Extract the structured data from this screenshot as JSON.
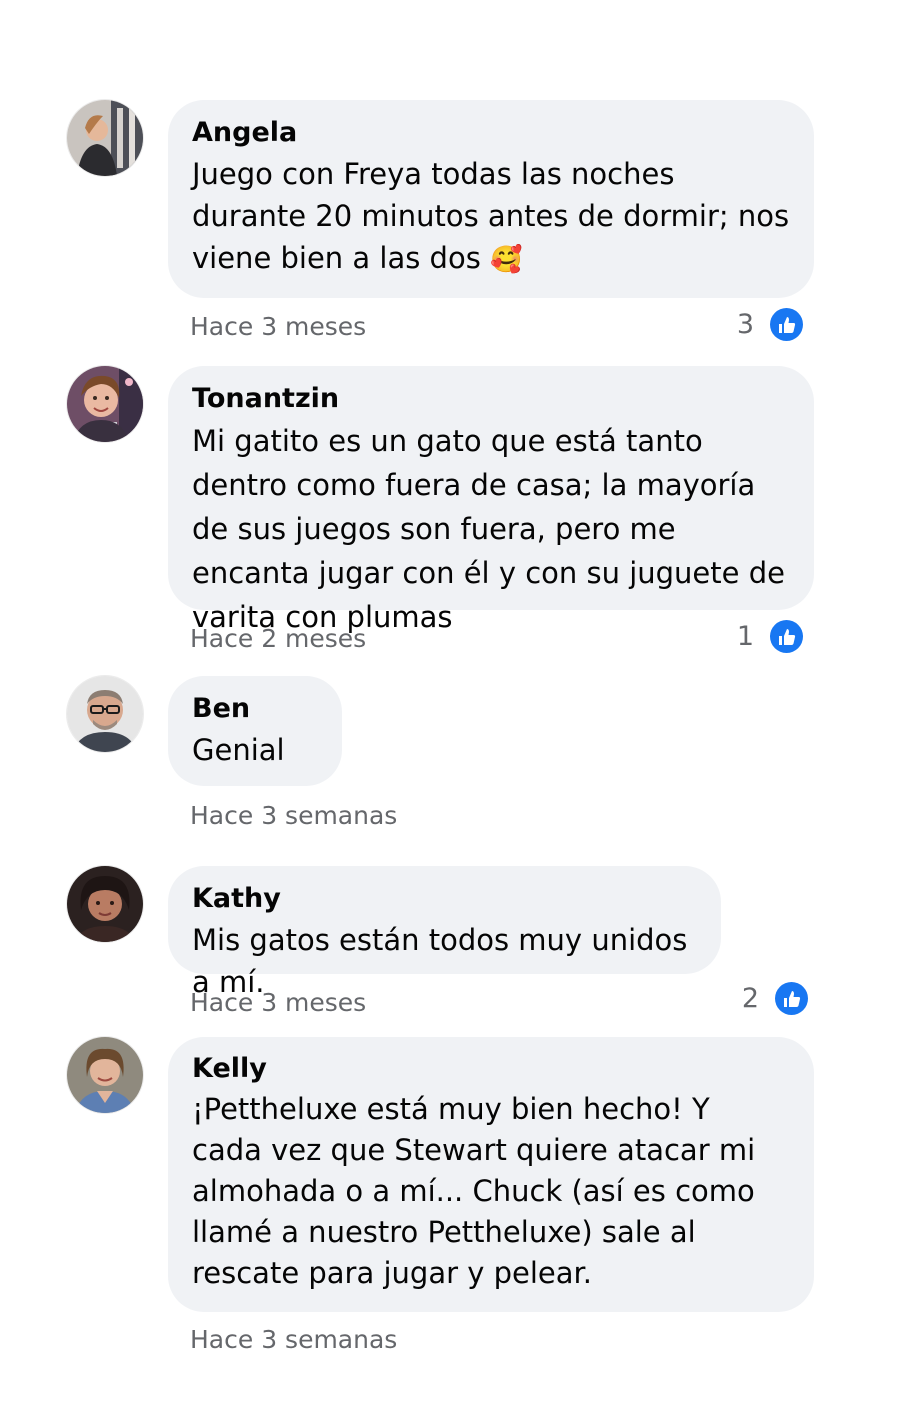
{
  "like_color": "#1877f2",
  "comments": [
    {
      "author": "Angela",
      "text": "Juego con Freya todas las noches durante 20 minutos antes de dormir; nos viene bien a las dos",
      "emoji": "🥰",
      "time": "Hace 3 meses",
      "likes": "3"
    },
    {
      "author": "Tonantzin",
      "text": "Mi gatito es un gato que está tanto dentro como fuera de casa; la mayoría de sus juegos son fuera, pero me encanta jugar con él y con su juguete de varita con plumas",
      "time": "Hace 2 meses",
      "likes": "1"
    },
    {
      "author": "Ben",
      "text": "Genial",
      "time": "Hace 3 semanas"
    },
    {
      "author": "Kathy",
      "text": "Mis gatos están todos muy unidos a mí.",
      "time": "Hace 3 meses",
      "likes": "2"
    },
    {
      "author": "Kelly",
      "text": "¡Pettheluxe está muy bien hecho! Y cada vez que Stewart quiere atacar mi almohada o a mí... Chuck (así es como llamé a nuestro Pettheluxe) sale al rescate para jugar y pelear.",
      "time": "Hace 3 semanas"
    }
  ]
}
